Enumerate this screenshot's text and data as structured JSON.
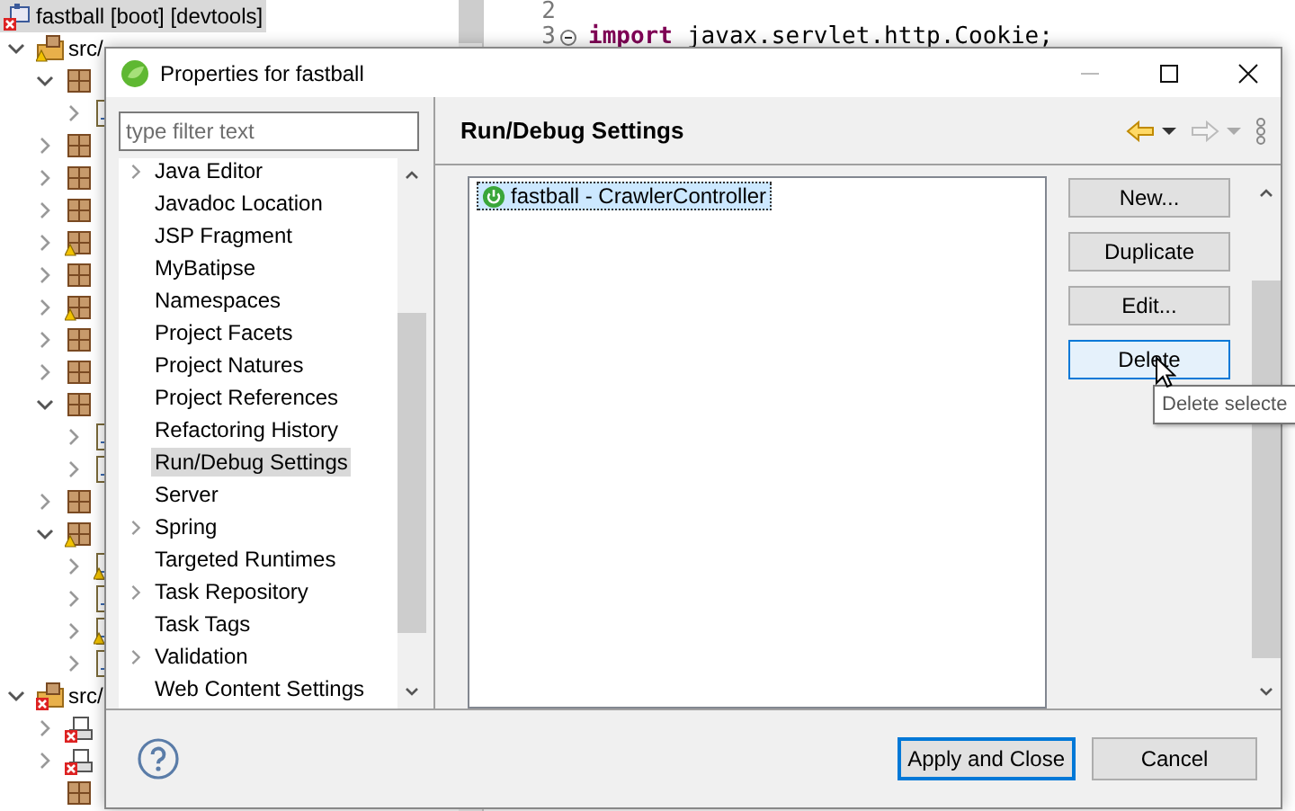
{
  "explorer": {
    "project": {
      "label": "fastball [boot] [devtools]",
      "selected": true
    },
    "tree": [
      {
        "label": "src/",
        "kind": "source-folder",
        "warning": true,
        "expanded": true,
        "children": [
          {
            "kind": "package",
            "expanded": true,
            "children": [
              {
                "kind": "file",
                "expanded": false
              }
            ]
          },
          {
            "kind": "package",
            "expanded": false
          },
          {
            "kind": "package",
            "expanded": false
          },
          {
            "kind": "package",
            "expanded": false
          },
          {
            "kind": "package",
            "warning": true,
            "expanded": false
          },
          {
            "kind": "package",
            "expanded": false
          },
          {
            "kind": "package",
            "warning": true,
            "expanded": false
          },
          {
            "kind": "package",
            "expanded": false
          },
          {
            "kind": "package",
            "expanded": false
          },
          {
            "kind": "package",
            "expanded": true,
            "children": [
              {
                "kind": "file",
                "expanded": false
              },
              {
                "kind": "file",
                "expanded": false
              }
            ]
          },
          {
            "kind": "package",
            "expanded": false
          },
          {
            "kind": "package",
            "warning": true,
            "expanded": true,
            "children": [
              {
                "kind": "file",
                "warning": true,
                "expanded": false
              },
              {
                "kind": "file",
                "expanded": false
              },
              {
                "kind": "file",
                "warning": true,
                "expanded": false
              },
              {
                "kind": "file",
                "expanded": false
              }
            ]
          }
        ]
      },
      {
        "label": "src/",
        "kind": "source-folder",
        "error": true,
        "expanded": true,
        "children": [
          {
            "kind": "library",
            "error": true,
            "expanded": false
          },
          {
            "kind": "library",
            "error": true,
            "expanded": false
          },
          {
            "kind": "package"
          }
        ]
      }
    ]
  },
  "editor": {
    "lines": [
      {
        "number": "2"
      },
      {
        "number": "3",
        "folded": true,
        "keyword": "import",
        "code": "javax.servlet.http.Cookie;"
      }
    ]
  },
  "dialog": {
    "title": "Properties for fastball",
    "filter": {
      "placeholder": "type filter text"
    },
    "pages": [
      {
        "label": "Java Editor",
        "expandable": true,
        "selected": false
      },
      {
        "label": "Javadoc Location",
        "expandable": false,
        "selected": false
      },
      {
        "label": "JSP Fragment",
        "expandable": false,
        "selected": false
      },
      {
        "label": "MyBatipse",
        "expandable": false,
        "selected": false
      },
      {
        "label": "Namespaces",
        "expandable": false,
        "selected": false
      },
      {
        "label": "Project Facets",
        "expandable": false,
        "selected": false
      },
      {
        "label": "Project Natures",
        "expandable": false,
        "selected": false
      },
      {
        "label": "Project References",
        "expandable": false,
        "selected": false
      },
      {
        "label": "Refactoring History",
        "expandable": false,
        "selected": false
      },
      {
        "label": "Run/Debug Settings",
        "expandable": false,
        "selected": true
      },
      {
        "label": "Server",
        "expandable": false,
        "selected": false
      },
      {
        "label": "Spring",
        "expandable": true,
        "selected": false
      },
      {
        "label": "Targeted Runtimes",
        "expandable": false,
        "selected": false
      },
      {
        "label": "Task Repository",
        "expandable": true,
        "selected": false
      },
      {
        "label": "Task Tags",
        "expandable": false,
        "selected": false
      },
      {
        "label": "Validation",
        "expandable": true,
        "selected": false
      },
      {
        "label": "Web Content Settings",
        "expandable": false,
        "selected": false
      }
    ],
    "page_title": "Run/Debug Settings",
    "nav": {
      "back_disabled": false,
      "forward_disabled": true
    },
    "launch_configs": [
      {
        "label": "fastball - CrawlerController",
        "selected": true
      }
    ],
    "buttons": [
      {
        "label": "New...",
        "hovered": false
      },
      {
        "label": "Duplicate",
        "hovered": false
      },
      {
        "label": "Edit...",
        "hovered": false
      },
      {
        "label": "Delete",
        "hovered": true
      }
    ],
    "tooltip": "Delete selecte",
    "footer_buttons": [
      {
        "label": "Apply and Close",
        "default": true
      },
      {
        "label": "Cancel",
        "default": false
      }
    ]
  }
}
